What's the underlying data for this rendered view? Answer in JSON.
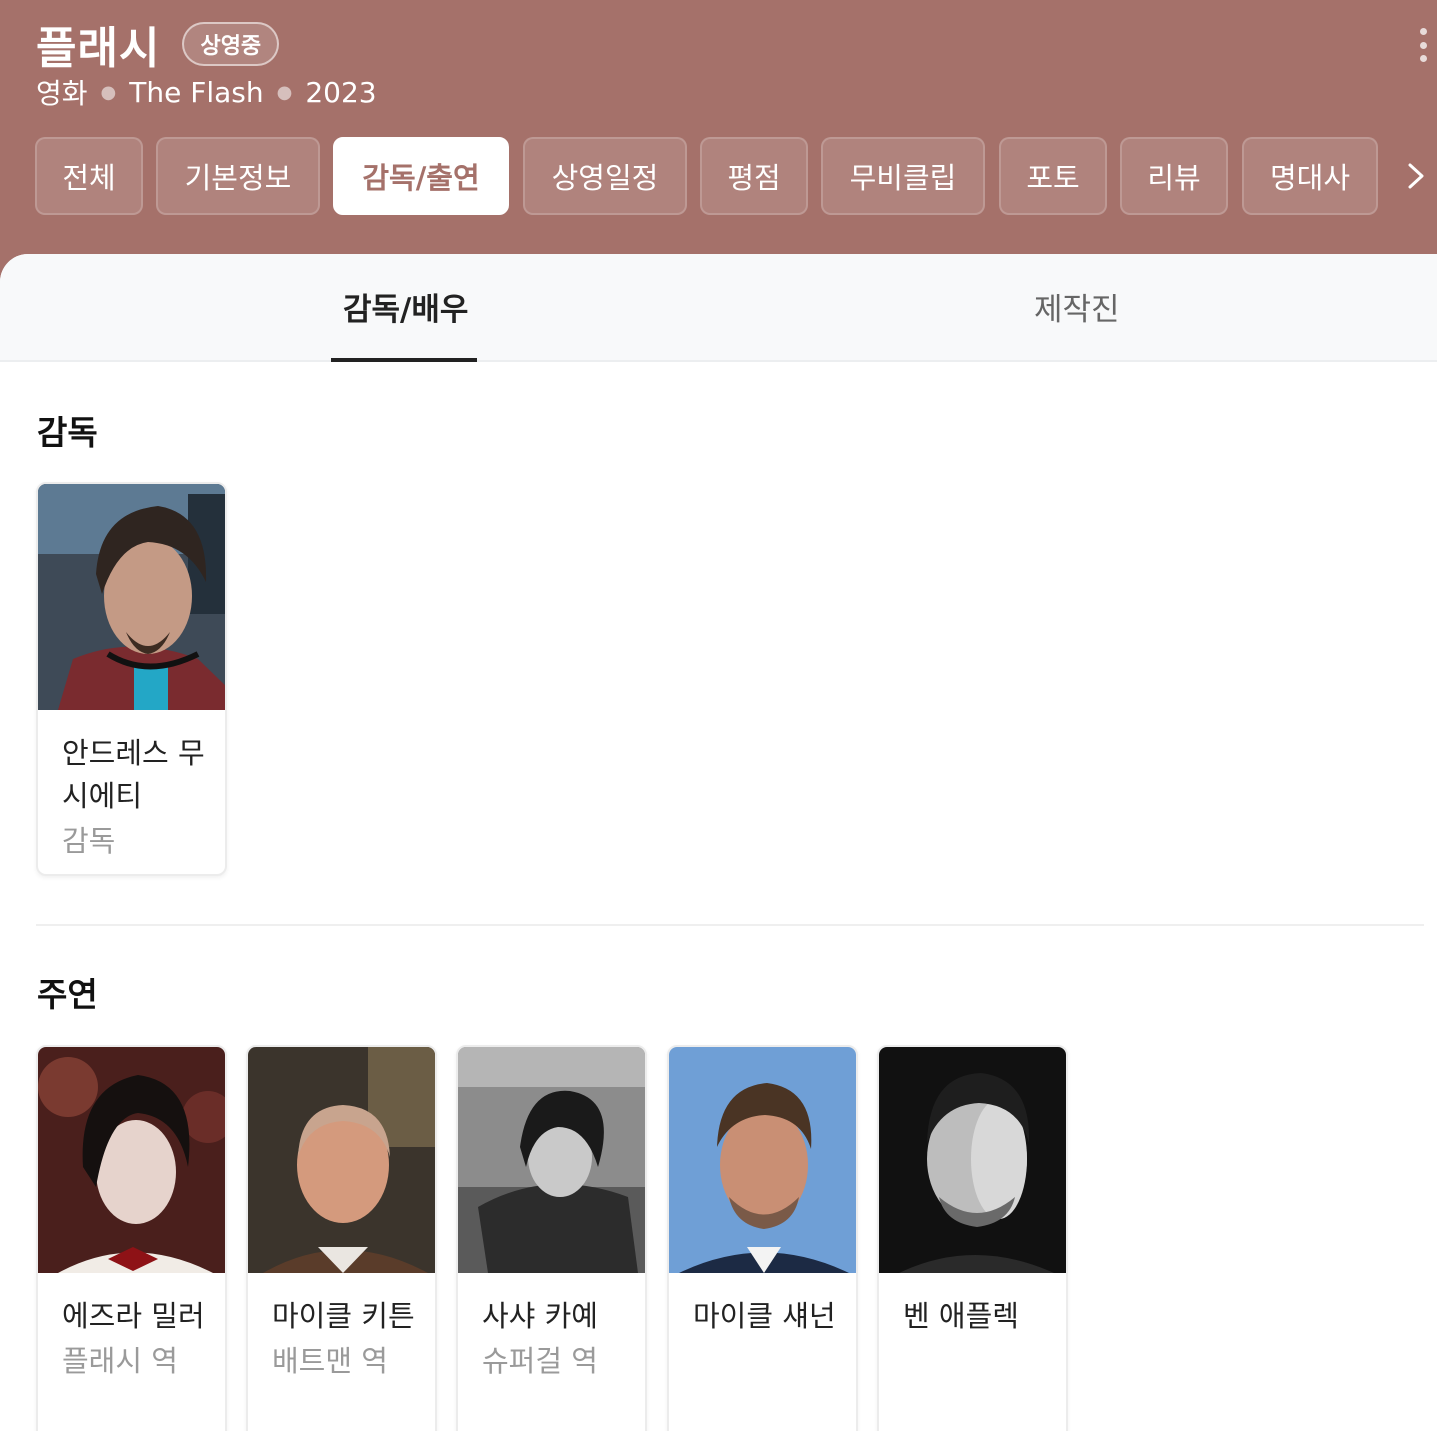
{
  "header": {
    "title": "플래시",
    "badge": "상영중",
    "meta": {
      "type": "영화",
      "original_title": "The Flash",
      "year": "2023"
    },
    "tabs": [
      {
        "label": "전체",
        "active": false
      },
      {
        "label": "기본정보",
        "active": false
      },
      {
        "label": "감독/출연",
        "active": true
      },
      {
        "label": "상영일정",
        "active": false
      },
      {
        "label": "평점",
        "active": false
      },
      {
        "label": "무비클립",
        "active": false
      },
      {
        "label": "포토",
        "active": false
      },
      {
        "label": "리뷰",
        "active": false
      },
      {
        "label": "명대사",
        "active": false
      }
    ]
  },
  "subtabs": [
    {
      "label": "감독/배우",
      "active": true
    },
    {
      "label": "제작진",
      "active": false
    }
  ],
  "sections": {
    "director": {
      "title": "감독",
      "people": [
        {
          "name": "안드레스 무시에티",
          "role": "감독"
        }
      ]
    },
    "cast": {
      "title": "주연",
      "people": [
        {
          "name": "에즈라 밀러",
          "role": "플래시 역"
        },
        {
          "name": "마이클 키튼",
          "role": "배트맨 역"
        },
        {
          "name": "사샤 카예",
          "role": "슈퍼걸 역"
        },
        {
          "name": "마이클 섀넌",
          "role": ""
        },
        {
          "name": "벤 애플렉",
          "role": ""
        }
      ]
    }
  },
  "colors": {
    "header_bg": "#a5716a",
    "active_tab_text": "#a5716a",
    "text_primary": "#222222",
    "text_secondary": "#9a9a9a"
  }
}
